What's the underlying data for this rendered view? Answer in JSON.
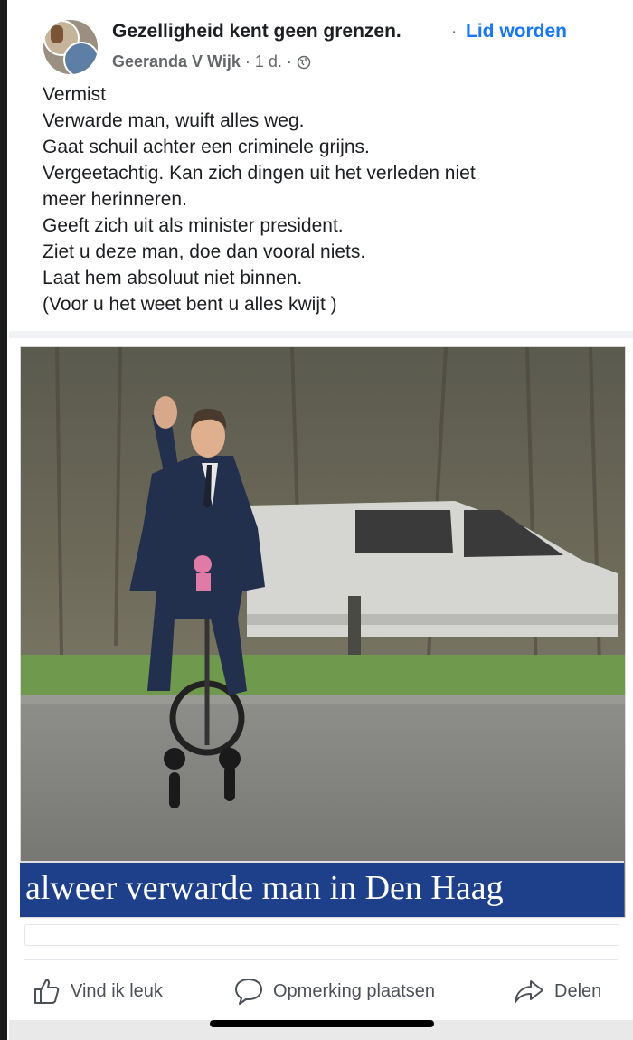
{
  "post": {
    "group_name": "Gezelligheid kent geen grenzen.",
    "separator": "·",
    "join_label": "Lid worden",
    "author": "Geeranda V Wijk",
    "time": "· 1 d. ·",
    "privacy_icon": "globe-icon",
    "text_lines": [
      "Vermist",
      "Verwarde man, wuift alles weg.",
      "Gaat schuil achter een criminele grijns.",
      "Vergeetachtig. Kan zich dingen uit het verleden niet",
      "meer herinneren.",
      "Geeft zich uit als minister president.",
      "Ziet u deze man, doe dan vooral niets.",
      "Laat hem absoluut niet binnen.",
      "(Voor u het weet bent u alles kwijt )"
    ],
    "image_caption": "alweer verwarde man in Den Haag"
  },
  "actions": {
    "like_label": "Vind ik leuk",
    "like_icon": "thumbs-up-icon",
    "comment_label": "Opmerking plaatsen",
    "comment_icon": "speech-bubble-icon",
    "share_label": "Delen",
    "share_icon": "share-arrow-icon"
  },
  "colors": {
    "link": "#1877f2",
    "caption_band": "#1e3f8a",
    "text": "#1c1e21",
    "secondary": "#65676b"
  }
}
